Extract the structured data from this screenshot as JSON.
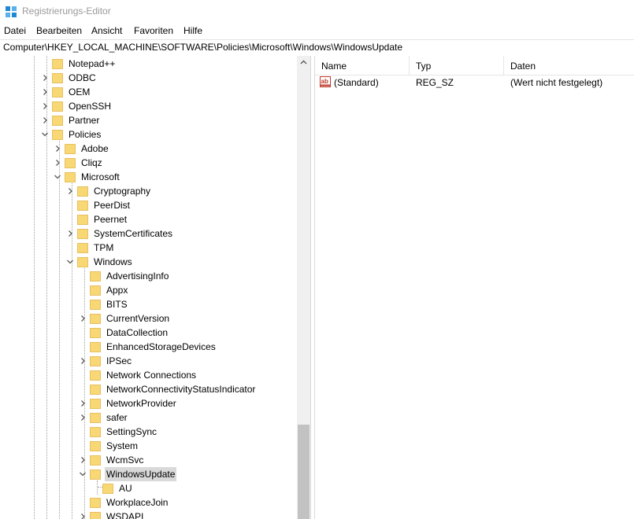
{
  "window": {
    "title": "Registrierungs-Editor"
  },
  "menu": [
    "Datei",
    "Bearbeiten",
    "Ansicht",
    "Favoriten",
    "Hilfe"
  ],
  "address": "Computer\\HKEY_LOCAL_MACHINE\\SOFTWARE\\Policies\\Microsoft\\Windows\\WindowsUpdate",
  "tree": [
    {
      "label": "Notepad++",
      "level": 0,
      "expander": "none"
    },
    {
      "label": "ODBC",
      "level": 0,
      "expander": "collapsed"
    },
    {
      "label": "OEM",
      "level": 0,
      "expander": "collapsed"
    },
    {
      "label": "OpenSSH",
      "level": 0,
      "expander": "collapsed"
    },
    {
      "label": "Partner",
      "level": 0,
      "expander": "collapsed"
    },
    {
      "label": "Policies",
      "level": 0,
      "expander": "expanded"
    },
    {
      "label": "Adobe",
      "level": 1,
      "expander": "collapsed"
    },
    {
      "label": "Cliqz",
      "level": 1,
      "expander": "collapsed"
    },
    {
      "label": "Microsoft",
      "level": 1,
      "expander": "expanded"
    },
    {
      "label": "Cryptography",
      "level": 2,
      "expander": "collapsed"
    },
    {
      "label": "PeerDist",
      "level": 2,
      "expander": "none"
    },
    {
      "label": "Peernet",
      "level": 2,
      "expander": "none"
    },
    {
      "label": "SystemCertificates",
      "level": 2,
      "expander": "collapsed"
    },
    {
      "label": "TPM",
      "level": 2,
      "expander": "none"
    },
    {
      "label": "Windows",
      "level": 2,
      "expander": "expanded"
    },
    {
      "label": "AdvertisingInfo",
      "level": 3,
      "expander": "none"
    },
    {
      "label": "Appx",
      "level": 3,
      "expander": "none"
    },
    {
      "label": "BITS",
      "level": 3,
      "expander": "none"
    },
    {
      "label": "CurrentVersion",
      "level": 3,
      "expander": "collapsed"
    },
    {
      "label": "DataCollection",
      "level": 3,
      "expander": "none"
    },
    {
      "label": "EnhancedStorageDevices",
      "level": 3,
      "expander": "none"
    },
    {
      "label": "IPSec",
      "level": 3,
      "expander": "collapsed"
    },
    {
      "label": "Network Connections",
      "level": 3,
      "expander": "none"
    },
    {
      "label": "NetworkConnectivityStatusIndicator",
      "level": 3,
      "expander": "none"
    },
    {
      "label": "NetworkProvider",
      "level": 3,
      "expander": "collapsed"
    },
    {
      "label": "safer",
      "level": 3,
      "expander": "collapsed"
    },
    {
      "label": "SettingSync",
      "level": 3,
      "expander": "none"
    },
    {
      "label": "System",
      "level": 3,
      "expander": "none"
    },
    {
      "label": "WcmSvc",
      "level": 3,
      "expander": "collapsed"
    },
    {
      "label": "WindowsUpdate",
      "level": 3,
      "expander": "expanded",
      "selected": true
    },
    {
      "label": "AU",
      "level": 4,
      "expander": "none"
    },
    {
      "label": "WorkplaceJoin",
      "level": 3,
      "expander": "none"
    },
    {
      "label": "WSDAPI",
      "level": 3,
      "expander": "collapsed"
    }
  ],
  "list": {
    "headers": {
      "name": "Name",
      "type": "Typ",
      "data": "Daten"
    },
    "rows": [
      {
        "name": "(Standard)",
        "type": "REG_SZ",
        "data": "(Wert nicht festgelegt)",
        "icon": "string-value-icon"
      }
    ]
  },
  "colors": {
    "folder": "#f8d775",
    "folder_edge": "#e3b54c",
    "selection": "#d9d9d9",
    "chevron": "#5a5a5a"
  },
  "icons": {
    "app": "registry-editor-icon",
    "value": "string-value-icon"
  }
}
